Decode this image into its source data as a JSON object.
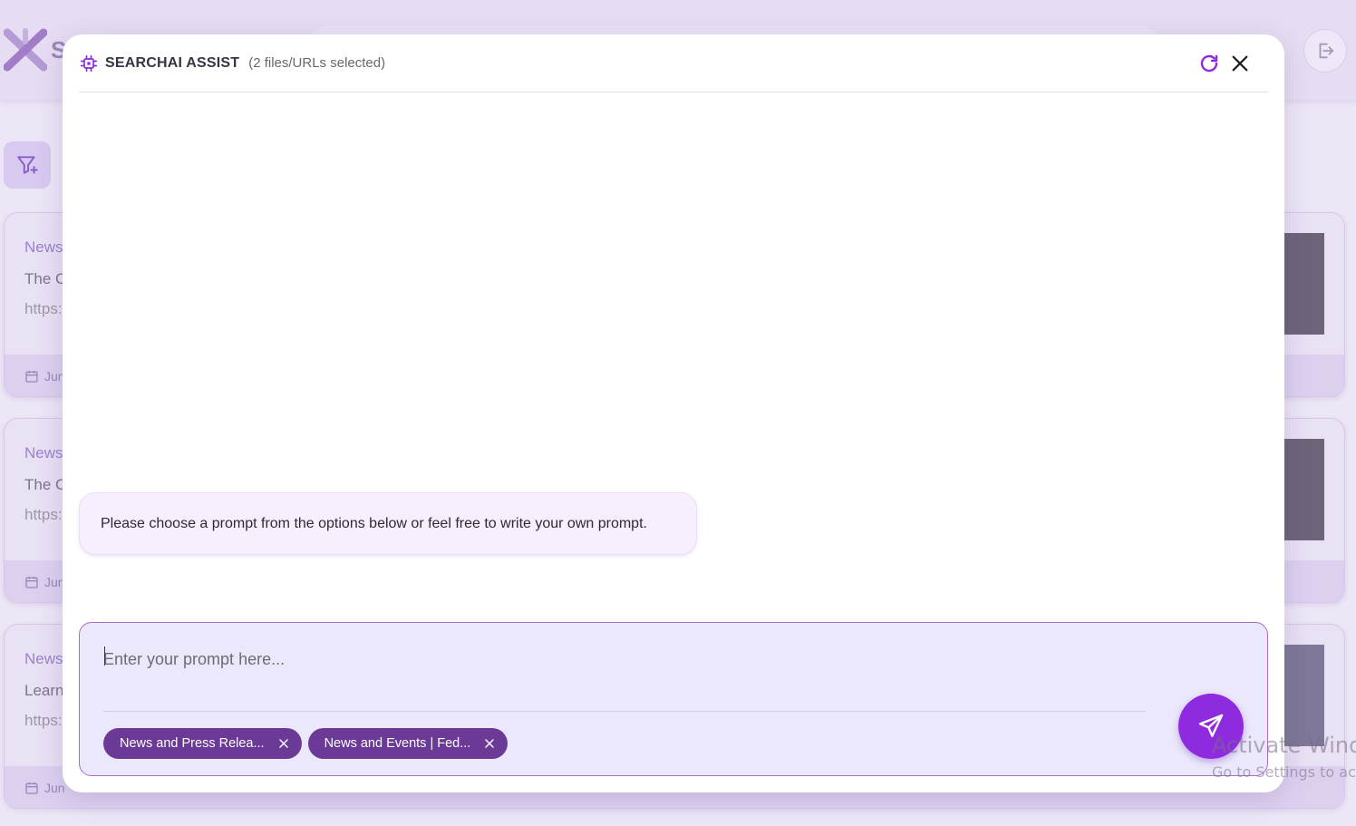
{
  "colors": {
    "accent": "#8f2bdf",
    "tag_bg": "#6a3a96",
    "composer_bg": "#ebe8fb",
    "composer_border": "#a96bc8",
    "bubble_bg": "#f8effd"
  },
  "background": {
    "logo_letter": "S",
    "cards": [
      {
        "category": "News",
        "title": "The C",
        "url": "https:",
        "date": "Jun"
      },
      {
        "category": "News",
        "title": "The C",
        "url": "https:",
        "date": "Jun"
      },
      {
        "category": "News",
        "title": "Learn",
        "url": "https:",
        "date": "Jun"
      }
    ],
    "watermark_line1": "Activate Windo",
    "watermark_line2": "Go to Settings to ac"
  },
  "modal": {
    "title": "SEARCHAI ASSIST",
    "subtitle": "(2 files/URLs selected)",
    "header_icon": "chip-icon",
    "refresh_icon": "refresh-icon",
    "close_icon": "close-icon",
    "message": "Please choose a prompt from the options below or feel free to write your own prompt."
  },
  "composer": {
    "value": "",
    "placeholder": "Enter your prompt here...",
    "tags": [
      {
        "label": "News and Press Relea..."
      },
      {
        "label": "News and Events | Fed..."
      }
    ],
    "send_icon": "send-icon"
  }
}
